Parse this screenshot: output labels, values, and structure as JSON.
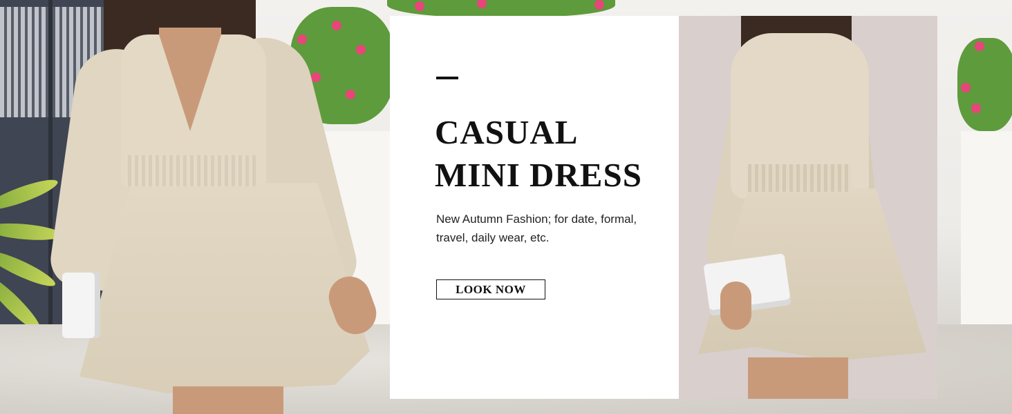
{
  "banner": {
    "title_line_1": "CASUAL",
    "title_line_2": "MINI DRESS",
    "description": "New Autumn Fashion; for date, formal, travel, daily wear, etc.",
    "cta_label": "LOOK NOW"
  },
  "colors": {
    "panel_background": "#ffffff",
    "text": "#111111",
    "photo_background": "#d9cfcd",
    "dress": "#e2d8c4"
  }
}
